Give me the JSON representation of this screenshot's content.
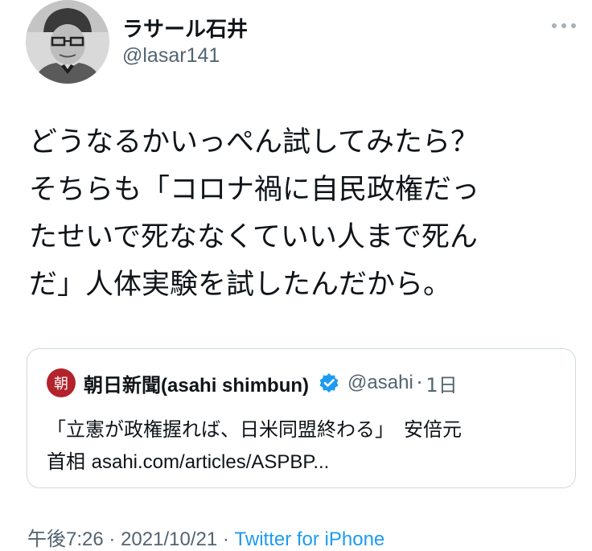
{
  "author": {
    "display_name": "ラサール石井",
    "handle": "@lasar141"
  },
  "tweet": {
    "text_lines": [
      "どうなるかいっぺん試してみたら？",
      "そちらも「コロナ禍に自民政権だっ",
      "たせいで死ななくていい人まで死ん",
      "だ」人体実験を試したんだから。"
    ]
  },
  "quoted_tweet": {
    "logo_glyph": "朝",
    "name_jp": "朝日新聞",
    "name_latin": "(asahi shimbun)",
    "handle": "@asahi",
    "separator": "·",
    "time": "1日",
    "body_line1": "「立憲が政権握れば、日米同盟終わる」　安倍元",
    "body_line2_prefix": "首相 ",
    "body_line2_url": "asahi.com/articles/ASPBP..."
  },
  "footer": {
    "time": "午後7:26",
    "separator": "·",
    "date": "2021/10/21",
    "source": "Twitter for iPhone"
  },
  "icons": {
    "more": "more-horizontal-icon",
    "verified": "verified-badge-icon"
  },
  "colors": {
    "text": "#0f1419",
    "secondary": "#536471",
    "accent": "#1d9bf0",
    "asahi_red": "#b2232c",
    "border": "#cfd9de"
  }
}
